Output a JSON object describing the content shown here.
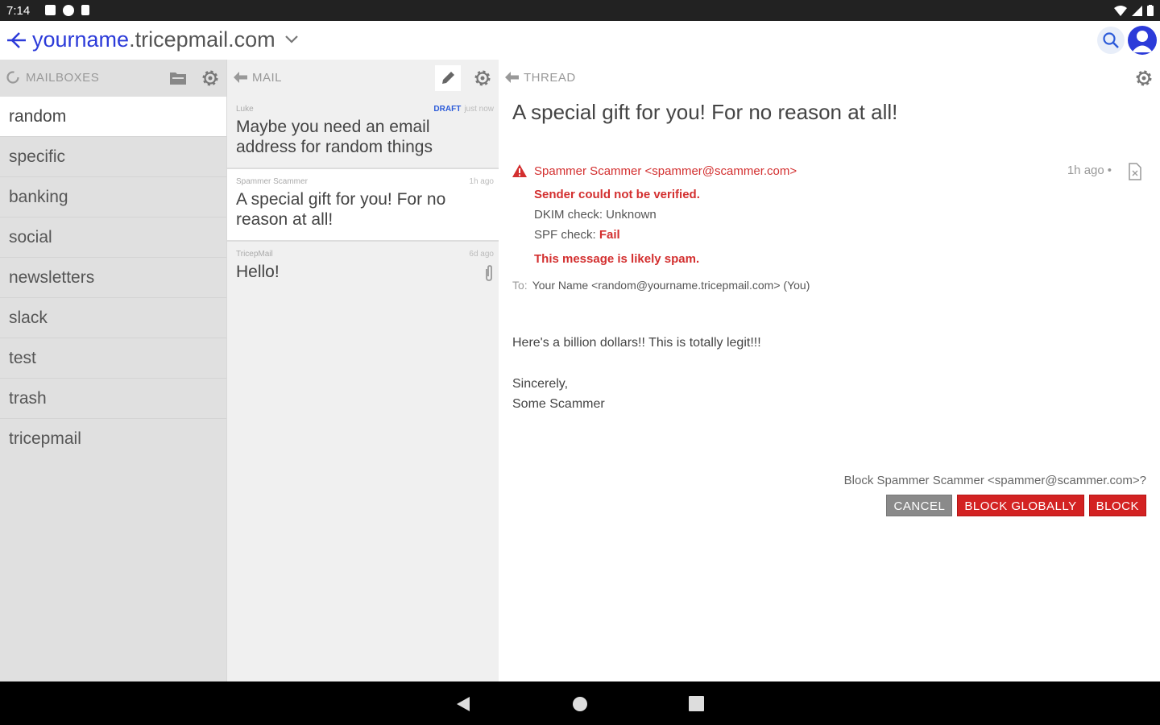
{
  "status_bar": {
    "time": "7:14"
  },
  "app_bar": {
    "account_user": "yourname",
    "account_domain": ".tricepmail.com"
  },
  "mailboxes": {
    "title": "MAILBOXES",
    "items": [
      {
        "label": "random",
        "active": true
      },
      {
        "label": "specific"
      },
      {
        "label": "banking"
      },
      {
        "label": "social"
      },
      {
        "label": "newsletters"
      },
      {
        "label": "slack"
      },
      {
        "label": "test"
      },
      {
        "label": "trash"
      },
      {
        "label": "tricepmail"
      }
    ]
  },
  "mail": {
    "title": "MAIL",
    "items": [
      {
        "from": "Luke",
        "draft": "DRAFT",
        "time": "just now",
        "subject": "Maybe you need an email address for random things"
      },
      {
        "from": "Spammer Scammer",
        "time": "1h ago",
        "subject": "A special gift for you! For no reason at all!"
      },
      {
        "from": "TricepMail",
        "time": "6d ago",
        "subject": "Hello!",
        "attachment": true
      }
    ]
  },
  "thread": {
    "title": "THREAD",
    "subject": "A special gift for you! For no reason at all!",
    "sender": "Spammer Scammer <spammer@scammer.com>",
    "time": "1h ago",
    "dot": "•",
    "not_verified": "Sender could not be verified.",
    "dkim_label": "DKIM check: Unknown",
    "spf_label": "SPF check: ",
    "spf_value": "Fail",
    "likely_spam": "This message is likely spam.",
    "to_label": "To:",
    "to_value": "Your Name <random@yourname.tricepmail.com> (You)",
    "body_line1": "Here's a billion dollars!! This is totally legit!!!",
    "body_line2": "Sincerely,",
    "body_line3": "Some Scammer",
    "block_prompt": "Block Spammer Scammer <spammer@scammer.com>?",
    "cancel_label": "CANCEL",
    "block_globally_label": "BLOCK GLOBALLY",
    "block_label": "BLOCK"
  },
  "colors": {
    "accent": "#2c3bd9",
    "danger": "#d32f2f",
    "sidebar_bg": "#e0e0e0"
  }
}
